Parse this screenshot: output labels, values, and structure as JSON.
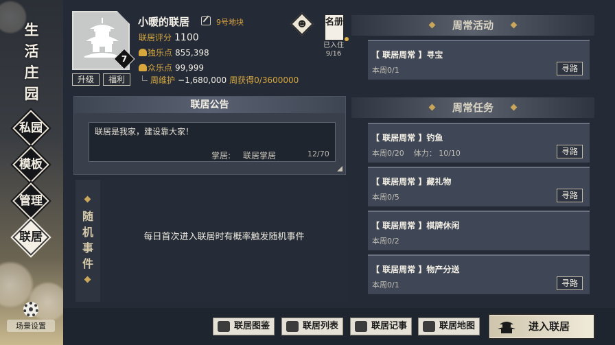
{
  "nav": {
    "title": "生活庄园",
    "items": [
      {
        "label": "私园",
        "active": false
      },
      {
        "label": "模板",
        "active": false
      },
      {
        "label": "管理",
        "active": false
      },
      {
        "label": "联居",
        "active": true
      }
    ],
    "scene_settings": "场景设置"
  },
  "header": {
    "level": "7",
    "upgrade_label": "升级",
    "welfare_label": "福利",
    "home_name": "小暖的联居",
    "plot": "9号地块",
    "rating_label": "联居评分",
    "rating_value": "1100",
    "solo_label": "独乐点",
    "solo_value": "855,398",
    "crowd_label": "众乐点",
    "crowd_value": "99,999",
    "maintenance_label": "周维护",
    "maintenance_value": "−1,680,000",
    "weekly_gain": "周获得0/3600000",
    "roster_label": "名册",
    "joined_label": "已入住",
    "joined_value": "9/16"
  },
  "announcement": {
    "title": "联居公告",
    "text": "联居是我家，建设靠大家！",
    "owner_label": "掌居:",
    "owner_name": "联居掌居",
    "char_count": "12/70"
  },
  "events": {
    "title_chars": [
      "随",
      "机",
      "事",
      "件"
    ],
    "description": "每日首次进入联居时有概率触发随机事件"
  },
  "weekly_activity": {
    "header": "周常活动",
    "tasks": [
      {
        "title": "【 联居周常 】寻宝",
        "progress": "本周0/1",
        "button": "寻路"
      }
    ]
  },
  "weekly_tasks": {
    "header": "周常任务",
    "tasks": [
      {
        "title": "【 联居周常 】钓鱼",
        "progress": "本周0/20",
        "stamina": "体力： 10/10",
        "button": "寻路"
      },
      {
        "title": "【 联居周常 】藏礼物",
        "progress": "本周0/5",
        "button": "寻路"
      },
      {
        "title": "【 联居周常 】棋牌休闲",
        "progress": "本周0/2"
      },
      {
        "title": "【 联居周常 】物产分送",
        "progress": "本周0/1",
        "button": "寻路"
      }
    ]
  },
  "bottom": {
    "catalog": "联居图鉴",
    "list": "联居列表",
    "records": "联居记事",
    "map": "联居地图",
    "enter": "进入联居"
  }
}
